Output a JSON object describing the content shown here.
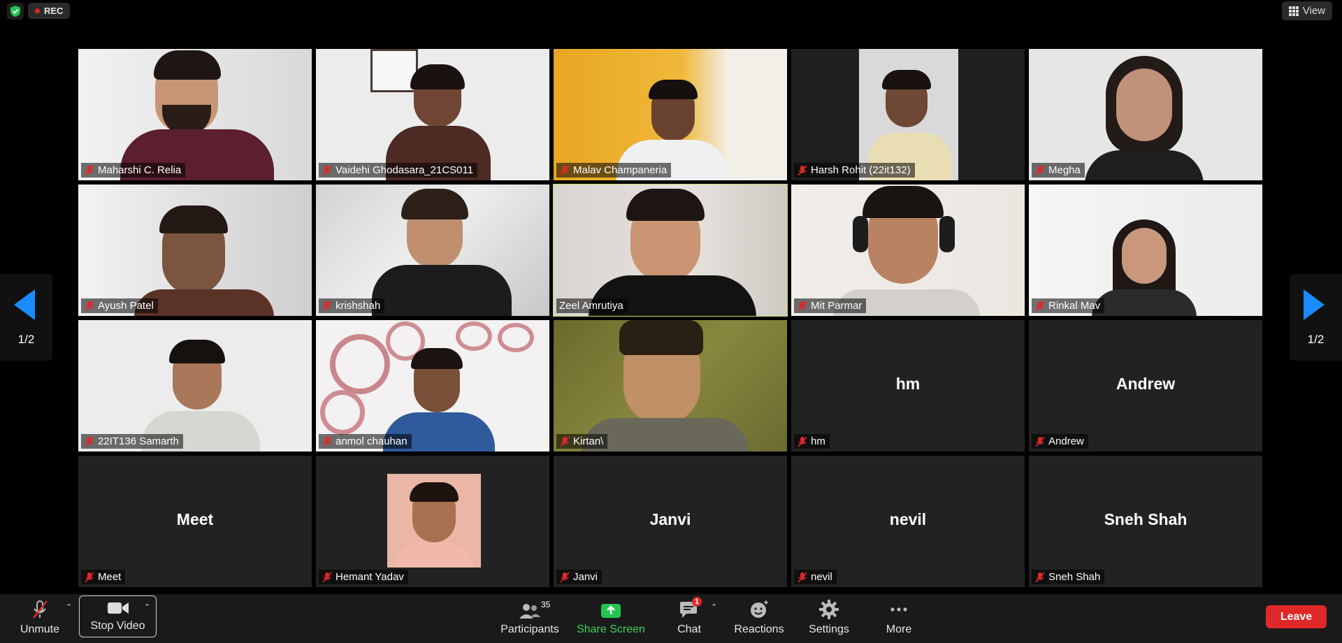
{
  "top_bar": {
    "rec_label": "REC",
    "view_label": "View"
  },
  "gallery": {
    "page_indicator_left": "1/2",
    "page_indicator_right": "1/2",
    "participants": [
      {
        "name": "Maharshi C. Relia",
        "video": true,
        "muted": true
      },
      {
        "name": "Vaidehi Ghodasara_21CS011",
        "video": true,
        "muted": true
      },
      {
        "name": "Malav Champaneria",
        "video": true,
        "muted": true
      },
      {
        "name": "Harsh Rohit (22it132)",
        "video": true,
        "muted": true
      },
      {
        "name": "Megha",
        "video": true,
        "muted": true
      },
      {
        "name": "Ayush Patel",
        "video": true,
        "muted": true
      },
      {
        "name": "krishshah",
        "video": true,
        "muted": true
      },
      {
        "name": "Zeel Amrutiya",
        "video": true,
        "muted": false,
        "active_speaker": true
      },
      {
        "name": "Mit Parmar",
        "video": true,
        "muted": true
      },
      {
        "name": "Rinkal Mav",
        "video": true,
        "muted": true
      },
      {
        "name": "22IT136 Samarth",
        "video": true,
        "muted": true
      },
      {
        "name": "anmol chauhan",
        "video": true,
        "muted": true
      },
      {
        "name": "Kirtan\\",
        "video": true,
        "muted": true
      },
      {
        "name": "hm",
        "video": false,
        "muted": true
      },
      {
        "name": "Andrew",
        "video": false,
        "muted": true
      },
      {
        "name": "Meet",
        "video": false,
        "muted": true
      },
      {
        "name": "Hemant Yadav",
        "video": false,
        "photo": true,
        "muted": true
      },
      {
        "name": "Janvi",
        "video": false,
        "muted": true
      },
      {
        "name": "nevil",
        "video": false,
        "muted": true
      },
      {
        "name": "Sneh Shah",
        "video": false,
        "muted": true
      }
    ]
  },
  "toolbar": {
    "unmute_label": "Unmute",
    "stop_video_label": "Stop Video",
    "participants_label": "Participants",
    "participants_count": "35",
    "share_screen_label": "Share Screen",
    "chat_label": "Chat",
    "chat_badge": "1",
    "reactions_label": "Reactions",
    "settings_label": "Settings",
    "more_label": "More",
    "leave_label": "Leave"
  },
  "colors": {
    "active_speaker_border": "#c6df6e",
    "share_green": "#3ecf59",
    "leave_red": "#e02828",
    "nav_arrow_blue": "#1a8cff"
  }
}
